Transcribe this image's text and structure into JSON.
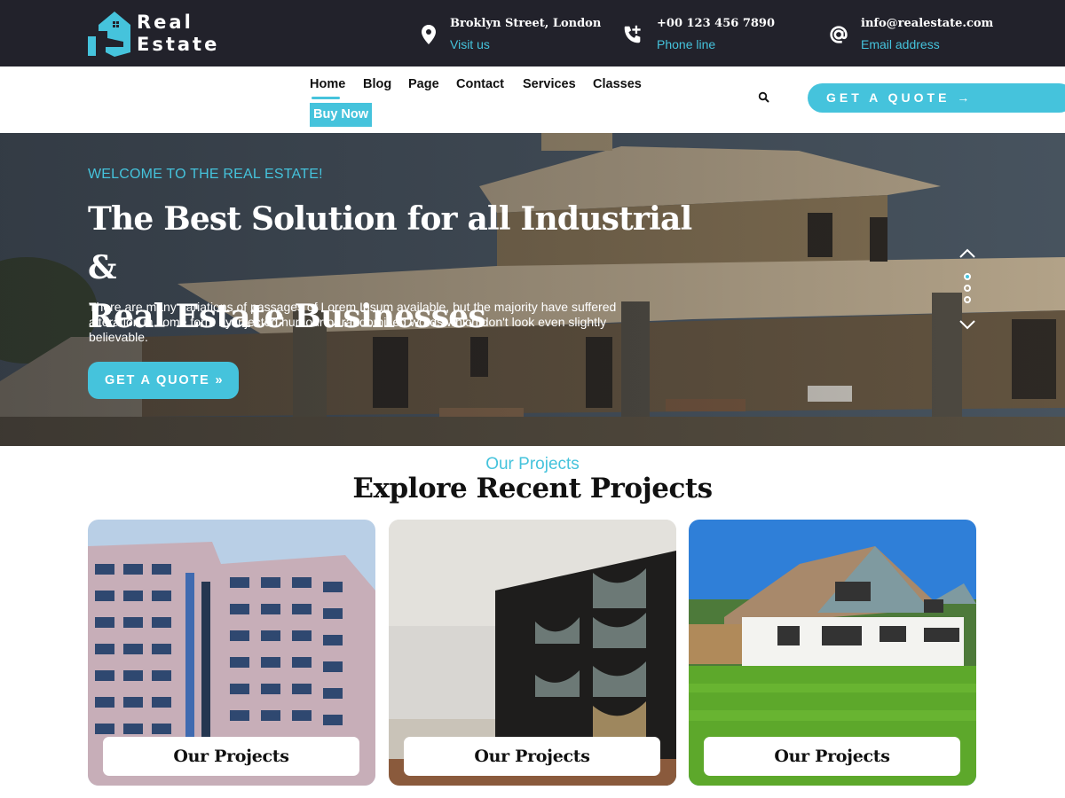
{
  "brand": {
    "line1": "Real",
    "line2": "Estate"
  },
  "topbar": {
    "contacts": [
      {
        "icon": "map-pin-icon",
        "title": "Broklyn Street, London",
        "subtitle": "Visit us"
      },
      {
        "icon": "phone-plus-icon",
        "title": "+00 123 456 7890",
        "subtitle": "Phone line"
      },
      {
        "icon": "at-sign-icon",
        "title": "info@realestate.com",
        "subtitle": "Email address"
      }
    ]
  },
  "nav": {
    "items": [
      {
        "label": "Home",
        "active": true
      },
      {
        "label": "Blog"
      },
      {
        "label": "Page"
      },
      {
        "label": "Contact"
      },
      {
        "label": "Services"
      },
      {
        "label": "Classes"
      }
    ],
    "buy_now": "Buy Now",
    "search_icon": "search-icon",
    "quote_button": "GET A QUOTE →"
  },
  "hero": {
    "eyebrow": "WELCOME TO THE REAL ESTATE!",
    "title_line1": "The Best Solution for all Industrial &",
    "title_line2": "Real Estate Businesses",
    "text": "There are many variations of passages of Lorem Ipsum available, but the majority have suffered alteration in some form by injected humour or randomised words which don't look even slightly believable.",
    "cta": "GET A QUOTE »",
    "slider": {
      "slides": 3,
      "active_index": 0
    }
  },
  "projects": {
    "eyebrow": "Our Projects",
    "title": "Explore Recent Projects",
    "cards": [
      {
        "label": "Our Projects",
        "image": "office-tower"
      },
      {
        "label": "Our Projects",
        "image": "apartment-building"
      },
      {
        "label": "Our Projects",
        "image": "suburban-house"
      }
    ]
  },
  "colors": {
    "accent": "#45c3dc",
    "topbar_bg": "#22222b",
    "text": "#111111"
  }
}
